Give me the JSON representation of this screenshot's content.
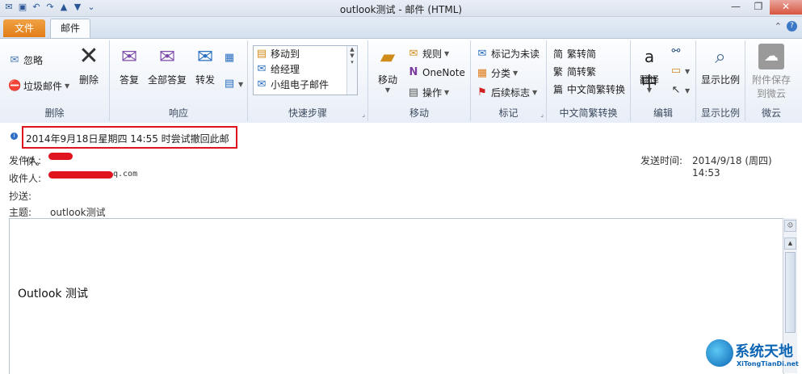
{
  "window": {
    "title": "outlook测试 - 邮件 (HTML)",
    "min": "—",
    "restore": "❐",
    "close": "✕"
  },
  "tabs": {
    "file": "文件",
    "mail": "邮件"
  },
  "ribbon": {
    "delete_group": {
      "label": "删除",
      "ignore": "忽略",
      "junk": "垃圾邮件",
      "delete": "删除"
    },
    "respond_group": {
      "label": "响应",
      "reply": "答复",
      "reply_all": "全部答复",
      "forward": "转发"
    },
    "quick_steps_group": {
      "label": "快速步骤",
      "items": [
        "移动到",
        "给经理",
        "小组电子邮件"
      ]
    },
    "move_group": {
      "label": "移动",
      "move": "移动",
      "rules": "规则",
      "onenote": "OneNote",
      "actions": "操作"
    },
    "tags_group": {
      "label": "标记",
      "mark_unread": "标记为未读",
      "categorize": "分类",
      "follow_up": "后续标志"
    },
    "chinese_group": {
      "label": "中文简繁转换",
      "to_simplified": "繁转简",
      "to_traditional": "简转繁",
      "convert": "中文简繁转换"
    },
    "edit_group": {
      "label": "编辑",
      "translate": "翻译"
    },
    "zoom_group": {
      "label": "显示比例",
      "zoom": "显示比例"
    },
    "weiyun_group": {
      "label": "微云",
      "save_attach_line1": "附件保存",
      "save_attach_line2": "到微云"
    }
  },
  "message": {
    "info": "2014年9月18日星期四 14:55 时尝试撤回此邮件。",
    "from_label": "发件人:",
    "to_label": "收件人:",
    "to_value": "q.com",
    "cc_label": "抄送:",
    "subject_label": "主题:",
    "subject_value": "outlook测试",
    "sent_label": "发送时间:",
    "sent_value": "2014/9/18 (周四) 14:53",
    "body": "Outlook 测试"
  },
  "watermark": {
    "title": "系统天地",
    "subtitle": "XiTongTianDi.net"
  }
}
